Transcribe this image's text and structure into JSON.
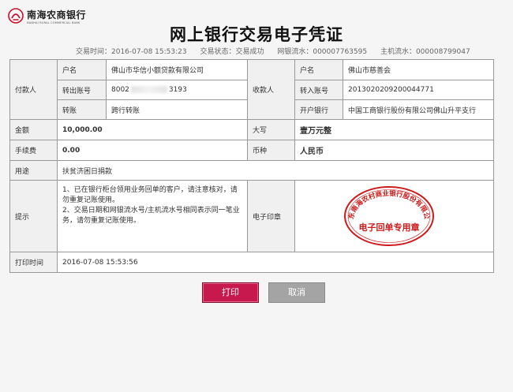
{
  "bank": {
    "name_cn": "南海农商银行",
    "name_en": "NANHAI RURAL COMMERCIAL BANK"
  },
  "title": "网上银行交易电子凭证",
  "meta": {
    "time": "交易时间：2016-07-08  15:53:23",
    "status": "交易状态：交易成功",
    "bank_serial": "网银流水：000007763595",
    "host_serial": "主机流水：000008799047"
  },
  "payer": {
    "section_label": "付款人",
    "name_label": "户名",
    "name": "佛山市华信小额贷款有限公司",
    "account_label": "转出账号",
    "account_prefix": "8002",
    "account_suffix": "3193",
    "transfer_label": "转账",
    "transfer_type": "跨行转账"
  },
  "payee": {
    "section_label": "收款人",
    "name_label": "户名",
    "name": "佛山市慈善会",
    "account_label": "转入账号",
    "account": "2013020209200044771",
    "bank_label": "开户银行",
    "bank": "中国工商银行股份有限公司佛山升平支行"
  },
  "amount": {
    "label": "金额",
    "value": "10,000.00",
    "upper_label": "大写",
    "upper_value": "壹万元整"
  },
  "fee": {
    "label": "手续费",
    "value": "0.00",
    "currency_label": "币种",
    "currency_value": "人民币"
  },
  "purpose": {
    "label": "用途",
    "value": "扶贫济困日捐款"
  },
  "notice": {
    "label": "提示",
    "line1": "1、已在银行柜台领用业务回单的客户，请注意核对，请勿重复记账使用。",
    "line2": "2、交易日期和网银流水号/主机流水号相同表示同一笔业务，请勿重复记账使用。"
  },
  "stamp": {
    "label": "电子印章",
    "arc_text": "广东南海农村商业银行股份有限公司",
    "center_text": "电子回单专用章",
    "color": "#cc1a1a"
  },
  "print_time": {
    "label": "打印时间",
    "value": "2016-07-08  15:53:56"
  },
  "buttons": {
    "print": "打印",
    "cancel": "取消"
  },
  "colors": {
    "print_button": "#c8194f",
    "cancel_button": "#a4a4a4",
    "logo_red": "#c8102e"
  }
}
